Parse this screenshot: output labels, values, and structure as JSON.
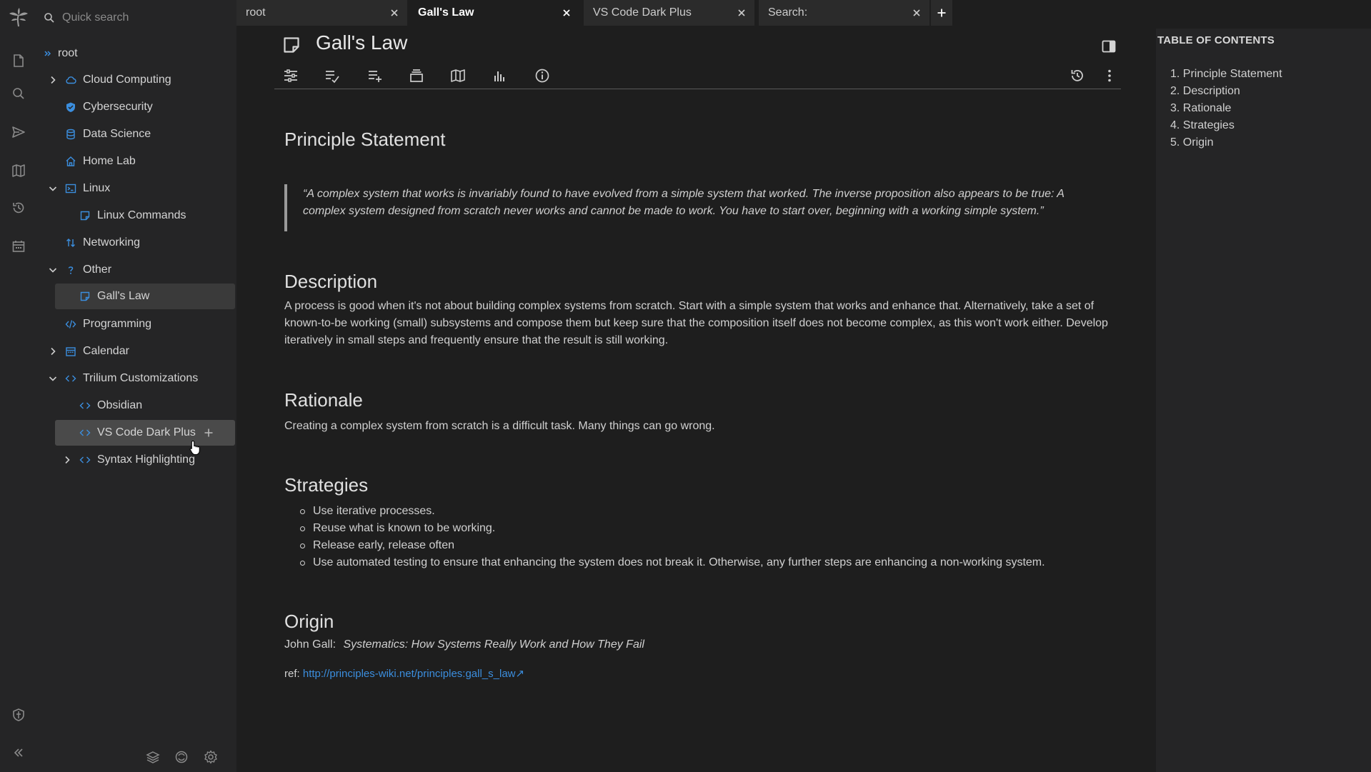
{
  "launcher": {
    "icons": [
      "trilium-logo-icon",
      "new-note-icon",
      "search-icon",
      "send-icon",
      "map-icon",
      "history-icon",
      "calendar-icon",
      "protected-session-icon",
      "collapse-sidebar-icon"
    ]
  },
  "search": {
    "placeholder": "Quick search"
  },
  "tree": {
    "root": "root",
    "items": [
      {
        "label": "Cloud Computing"
      },
      {
        "label": "Cybersecurity"
      },
      {
        "label": "Data Science"
      },
      {
        "label": "Home Lab"
      },
      {
        "label": "Linux"
      },
      {
        "label": "Linux Commands"
      },
      {
        "label": "Networking"
      },
      {
        "label": "Other"
      },
      {
        "label": "Gall's Law"
      },
      {
        "label": "Programming"
      },
      {
        "label": "Calendar"
      },
      {
        "label": "Trilium Customizations"
      },
      {
        "label": "Obsidian"
      },
      {
        "label": "VS Code Dark Plus"
      },
      {
        "label": "Syntax Highlighting"
      }
    ],
    "footer_icons": [
      "layers-icon",
      "sync-icon",
      "settings-icon"
    ]
  },
  "tabs": [
    {
      "label": "root"
    },
    {
      "label": "Gall's Law"
    },
    {
      "label": "VS Code Dark Plus"
    },
    {
      "label": "Search:"
    }
  ],
  "note": {
    "title": "Gall's Law",
    "ribbon_icons": [
      "note-properties-icon",
      "edit-icon",
      "insert-icon",
      "collection-icon",
      "note-map-icon",
      "stats-icon",
      "info-icon"
    ],
    "sections": {
      "principle_heading": "Principle Statement",
      "quote": "“A complex system that works is invariably found to have evolved from a simple system that worked. The inverse proposition also appears to be true: A complex system designed from scratch never works and cannot be made to work. You have to start over, beginning with a working simple system.”",
      "description_heading": "Description",
      "description": "A process is good when it's not about building complex systems from scratch. Start with a simple system that works and enhance that. Alternatively, take a set of known-to-be working (small) subsystems and compose them but keep sure that the composition itself does not become complex, as this won't work either. Develop iteratively in small steps and frequently ensure that the result is still working.",
      "rationale_heading": "Rationale",
      "rationale": "Creating a complex system from scratch is a difficult task. Many things can go wrong.",
      "strategies_heading": "Strategies",
      "strategies": [
        "Use iterative processes.",
        "Reuse what is known to be working.",
        "Release early, release often",
        "Use automated testing to ensure that enhancing the system does not break it. Otherwise, any further steps are enhancing a non-working system."
      ],
      "origin_heading": "Origin",
      "origin_author": "John Gall:",
      "origin_book": "Systematics: How Systems Really Work and How They Fail",
      "ref_label": "ref:",
      "ref_link": "http://principles-wiki.net/principles:gall_s_law↗"
    }
  },
  "toc": {
    "title": "TABLE OF CONTENTS",
    "items": [
      "1. Principle Statement",
      "2. Description",
      "3. Rationale",
      "4. Strategies",
      "5. Origin"
    ]
  },
  "colors": {
    "accent": "#3b8ede",
    "sidebar_bg": "#252526",
    "editor_bg": "#1e1e1e"
  }
}
